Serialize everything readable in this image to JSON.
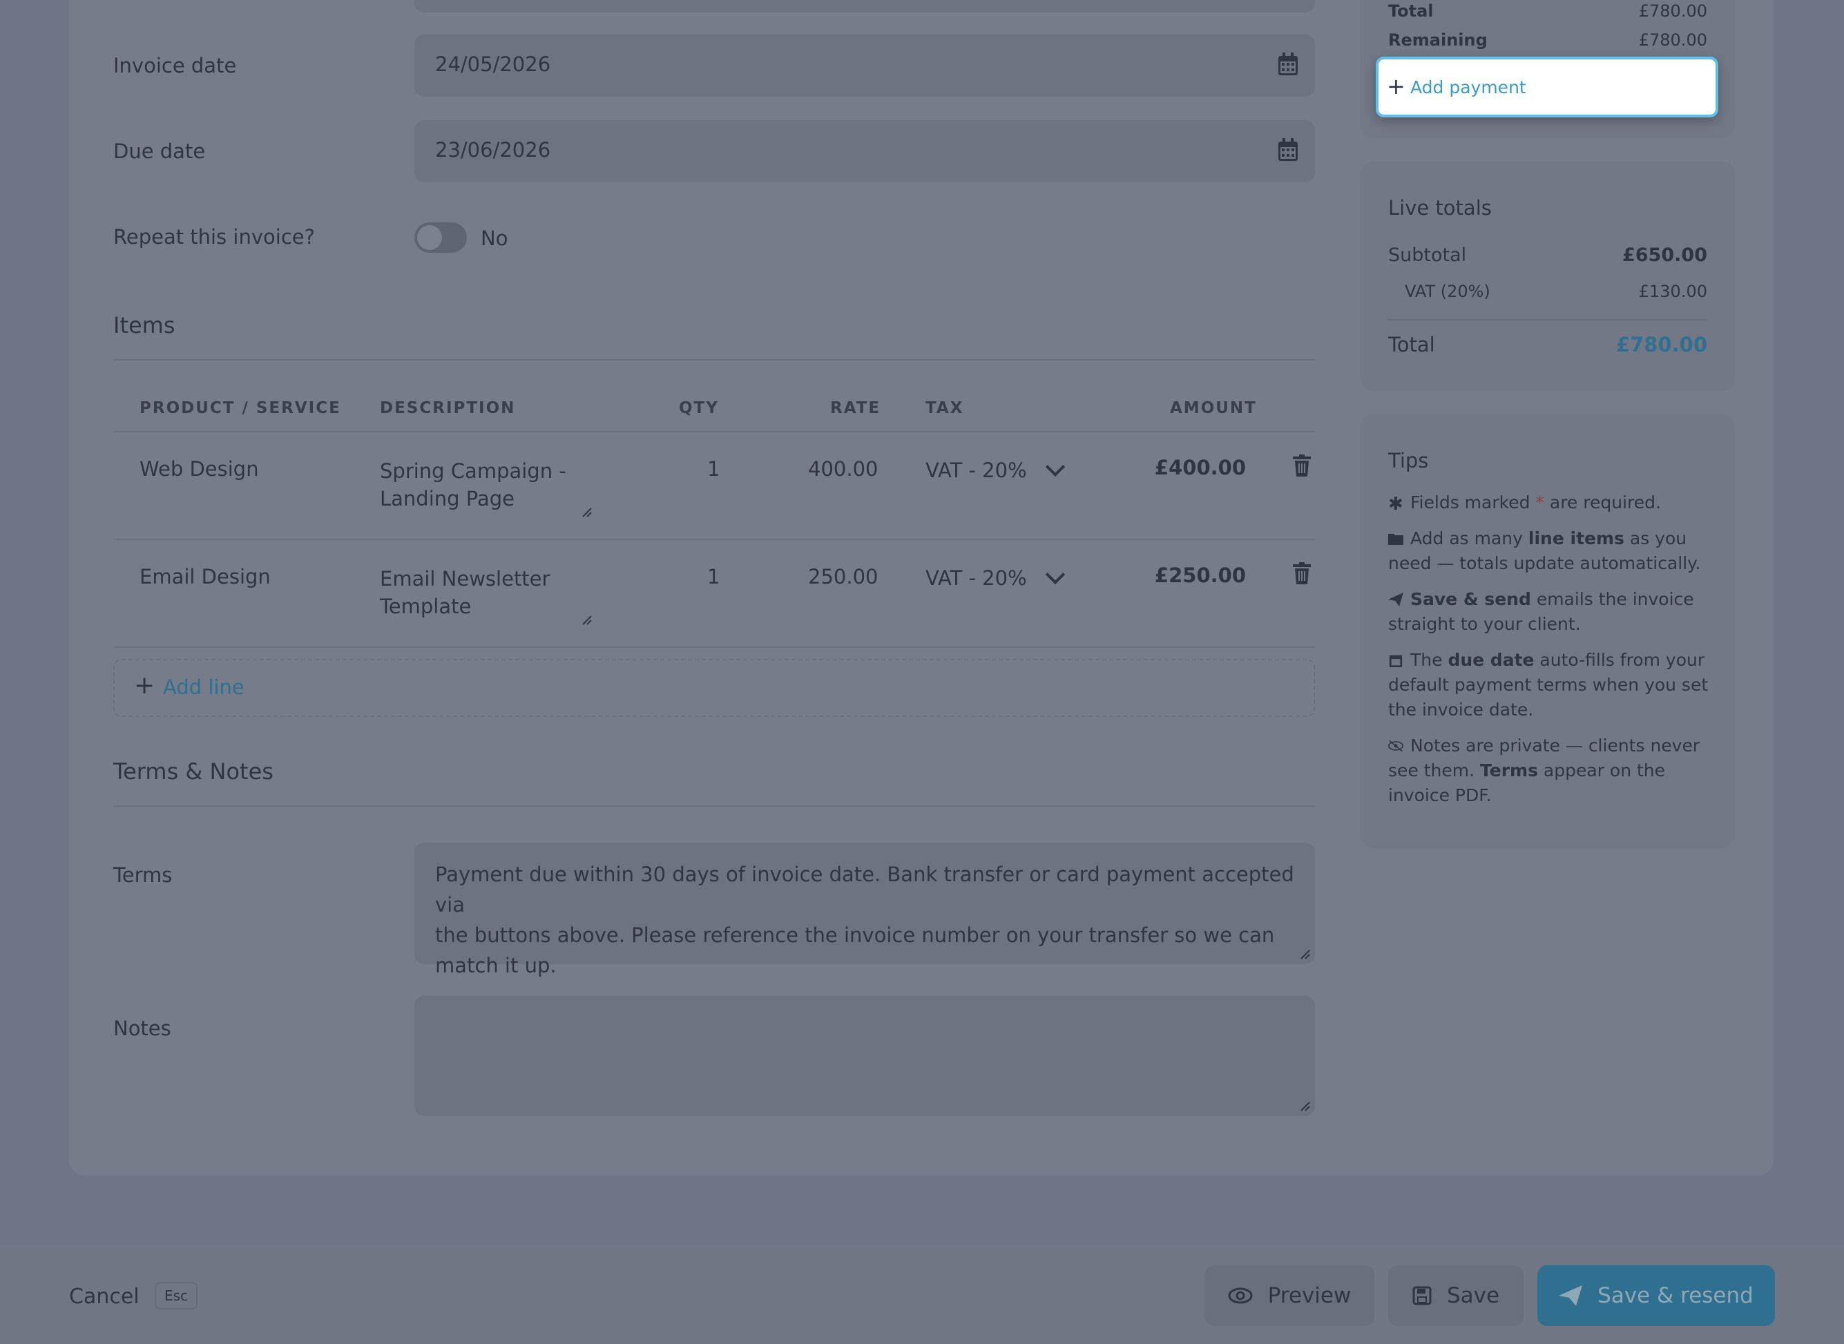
{
  "form": {
    "invoice_date_label": "Invoice date",
    "invoice_date_value": "24/05/2026",
    "due_date_label": "Due date",
    "due_date_value": "23/06/2026",
    "repeat_label": "Repeat this invoice?",
    "repeat_state": "No"
  },
  "items": {
    "title": "Items",
    "headers": [
      "PRODUCT / SERVICE",
      "DESCRIPTION",
      "QTY",
      "RATE",
      "TAX",
      "AMOUNT"
    ],
    "rows": [
      {
        "product": "Web Design",
        "desc1": "Spring Campaign -",
        "desc2": "Landing Page",
        "qty": "1",
        "rate": "400.00",
        "tax": "VAT - 20%",
        "amount": "£400.00"
      },
      {
        "product": "Email Design",
        "desc1": "Email Newsletter",
        "desc2": "Template",
        "qty": "1",
        "rate": "250.00",
        "tax": "VAT - 20%",
        "amount": "£250.00"
      }
    ],
    "add_line_label": "Add line"
  },
  "terms": {
    "title": "Terms & Notes",
    "terms_label": "Terms",
    "terms_line1": "Payment due within 30 days of invoice date. Bank transfer or card payment accepted via",
    "terms_line2": "the buttons above. Please reference the invoice number on your transfer so we can",
    "terms_line3": "match it up.",
    "notes_label": "Notes",
    "notes_value": ""
  },
  "payments": {
    "total_label": "Total",
    "total_value": "£780.00",
    "remaining_label": "Remaining",
    "remaining_value": "£780.00",
    "add_payment_label": "Add payment"
  },
  "live_totals": {
    "title": "Live totals",
    "subtotal_label": "Subtotal",
    "subtotal_value": "£650.00",
    "vat_label": "VAT (20%)",
    "vat_value": "£130.00",
    "total_label": "Total",
    "total_value": "£780.00"
  },
  "tips": {
    "title": "Tips",
    "t1_a": "Fields marked ",
    "t1_star": "*",
    "t1_b": " are required.",
    "t2_a": "Add as many ",
    "t2_bold": "line items",
    "t2_b": " as you need — totals update automatically.",
    "t3_bold": "Save & send",
    "t3_b": " emails the invoice straight to your client.",
    "t4_a": "The ",
    "t4_bold": "due date",
    "t4_b": " auto-fills from your default payment terms when you set the invoice date.",
    "t5_a": "Notes are private — clients never see them. ",
    "t5_bold": "Terms",
    "t5_b": " appear on the invoice PDF."
  },
  "footer": {
    "cancel_label": "Cancel",
    "esc_label": "Esc",
    "preview_label": "Preview",
    "save_label": "Save",
    "save_resend_label": "Save & resend"
  },
  "colors": {
    "accent": "#2f6f8f",
    "accent_link": "#3b9bc4",
    "focus_ring": "#5fc0ea"
  }
}
